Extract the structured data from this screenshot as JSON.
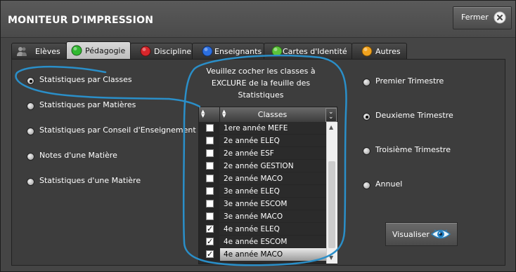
{
  "window": {
    "title": "MONITEUR D'IMPRESSION",
    "close_label": "Fermer",
    "close_icon": "close-circle-icon"
  },
  "tabs": [
    {
      "label": "Elèves",
      "icon": "students-icon",
      "active": false
    },
    {
      "label": "Pédagogie",
      "icon": "green-circle-icon",
      "color": "#2fb82f",
      "active": true
    },
    {
      "label": "Discipline",
      "icon": "red-circle-icon",
      "color": "#d8262b",
      "active": false
    },
    {
      "label": "Enseignants",
      "icon": "blue-circle-icon",
      "color": "#2c6fe0",
      "active": false
    },
    {
      "label": "Cartes d'Identité",
      "icon": "green-circle-icon",
      "color": "#5cc43a",
      "active": false
    },
    {
      "label": "Autres",
      "icon": "orange-circle-icon",
      "color": "#f0a21e",
      "active": false
    }
  ],
  "stats_options": {
    "selected": "Statistiques par Classes",
    "items": [
      "Statistiques par Classes",
      "Statistiques par Matières",
      "Statistiques par Conseil d'Enseignement",
      "Notes d'une Matière",
      "Statistiques d'une Matière"
    ]
  },
  "exclusion": {
    "instruction": "Veuillez cocher les classes à EXCLURE de la feuille des Statistiques",
    "column_header": "Classes",
    "rows": [
      {
        "label": "1ere année MEFE",
        "checked": false,
        "selected": false
      },
      {
        "label": "2e année ELEQ",
        "checked": false,
        "selected": false
      },
      {
        "label": "2e année ESF",
        "checked": false,
        "selected": false
      },
      {
        "label": "2e année GESTION",
        "checked": false,
        "selected": false
      },
      {
        "label": "2e année MACO",
        "checked": false,
        "selected": false
      },
      {
        "label": "3e année ELEQ",
        "checked": false,
        "selected": false
      },
      {
        "label": "3e année ESCOM",
        "checked": false,
        "selected": false
      },
      {
        "label": "3e année MACO",
        "checked": false,
        "selected": false
      },
      {
        "label": "4e année ELEQ",
        "checked": true,
        "selected": false
      },
      {
        "label": "4e année ESCOM",
        "checked": true,
        "selected": false
      },
      {
        "label": "4e année MACO",
        "checked": true,
        "selected": true
      }
    ]
  },
  "trimesters": {
    "selected": "Deuxieme Trimestre",
    "items": [
      "Premier Trimestre",
      "Deuxieme Trimestre",
      "Troisième Trimestre",
      "Annuel"
    ]
  },
  "visualiser": {
    "label": "Visualiser",
    "icon": "eye-icon"
  },
  "annotation_color": "#2a8fc9"
}
